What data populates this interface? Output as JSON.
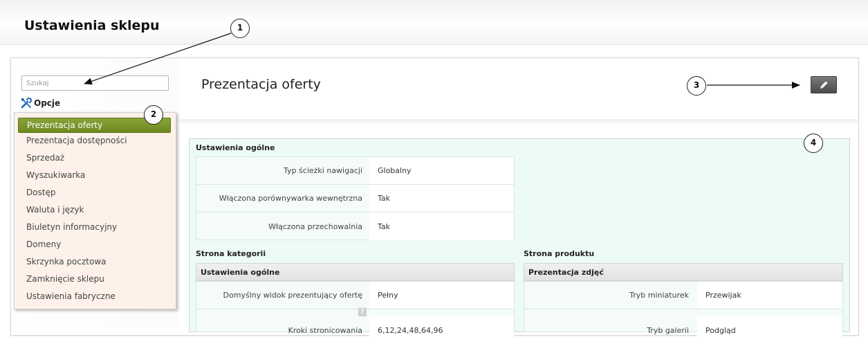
{
  "page": {
    "title": "Ustawienia sklepu"
  },
  "sidebar": {
    "search_placeholder": "Szukaj",
    "options_label": "Opcje",
    "items": [
      {
        "label": "Prezentacja oferty",
        "active": true
      },
      {
        "label": "Prezentacja dostępności"
      },
      {
        "label": "Sprzedaż"
      },
      {
        "label": "Wyszukiwarka"
      },
      {
        "label": "Dostęp"
      },
      {
        "label": "Waluta i język"
      },
      {
        "label": "Biuletyn informacyjny"
      },
      {
        "label": "Domeny"
      },
      {
        "label": "Skrzynka pocztowa"
      },
      {
        "label": "Zamknięcie sklepu"
      },
      {
        "label": "Ustawienia fabryczne"
      }
    ]
  },
  "content": {
    "title": "Prezentacja oferty",
    "general": {
      "title": "Ustawienia ogólne",
      "rows": [
        {
          "label": "Typ ścieżki nawigacji",
          "value": "Globalny"
        },
        {
          "label": "Włączona porównywarka wewnętrzna",
          "value": "Tak"
        },
        {
          "label": "Włączona przechowalnia",
          "value": "Tak"
        }
      ]
    },
    "category": {
      "title": "Strona kategorii",
      "subtitle": "Ustawienia ogólne",
      "rows": [
        {
          "label": "Domyślny widok prezentujący ofertę",
          "value": "Pełny"
        },
        {
          "label": "Kroki stronicowania",
          "value": "6,12,24,48,64,96",
          "help": "?"
        }
      ]
    },
    "product": {
      "title": "Strona produktu",
      "subtitle": "Prezentacja zdjęć",
      "rows": [
        {
          "label": "Tryb miniaturek",
          "value": "Przewijak"
        },
        {
          "label": "Tryb galerii",
          "value": "Podgląd"
        }
      ]
    }
  },
  "callouts": [
    "1",
    "2",
    "3",
    "4"
  ],
  "icons": {
    "options": "tools-icon",
    "edit": "pencil-icon"
  },
  "colors": {
    "active_item": "#7a9a2b",
    "menu_bg": "#fdf1ea",
    "panel_bg": "#ecfbf4",
    "edit_button": "#5a5a5a"
  }
}
